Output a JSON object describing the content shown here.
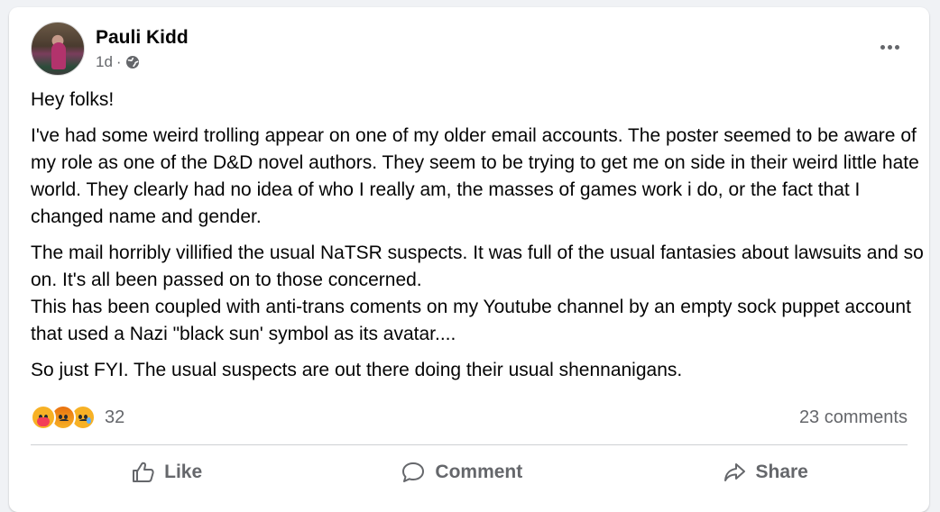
{
  "post": {
    "author": "Pauli Kidd",
    "time": "1d",
    "separator": "·",
    "privacy_icon": "globe-icon",
    "paragraphs": [
      "Hey folks!",
      "I've had some weird trolling appear on one of my older email accounts. The poster seemed to be aware of my role as one of the D&D novel authors. They seem to be trying to get me on side in their weird little hate world. They clearly had no idea of who I really am, the masses of games work i do, or the fact that I changed name and gender.",
      "The mail horribly villified the usual NaTSR suspects. It was full of the usual fantasies about lawsuits and so on. It's all been passed on to those concerned.",
      "This has been coupled with anti-trans coments on my Youtube channel by an empty sock puppet account that used a Nazi \"black sun' symbol as its avatar....",
      "So just FYI. The usual suspects are out there doing their usual shennanigans."
    ]
  },
  "reactions": {
    "icons": [
      "care-emoji-icon",
      "angry-emoji-icon",
      "sad-emoji-icon"
    ],
    "count": "32",
    "comments": "23 comments"
  },
  "actions": {
    "like": "Like",
    "comment": "Comment",
    "share": "Share"
  },
  "colors": {
    "background": "#f0f2f5",
    "card": "#ffffff",
    "secondary_text": "#65676b",
    "divider": "#ced0d4"
  }
}
